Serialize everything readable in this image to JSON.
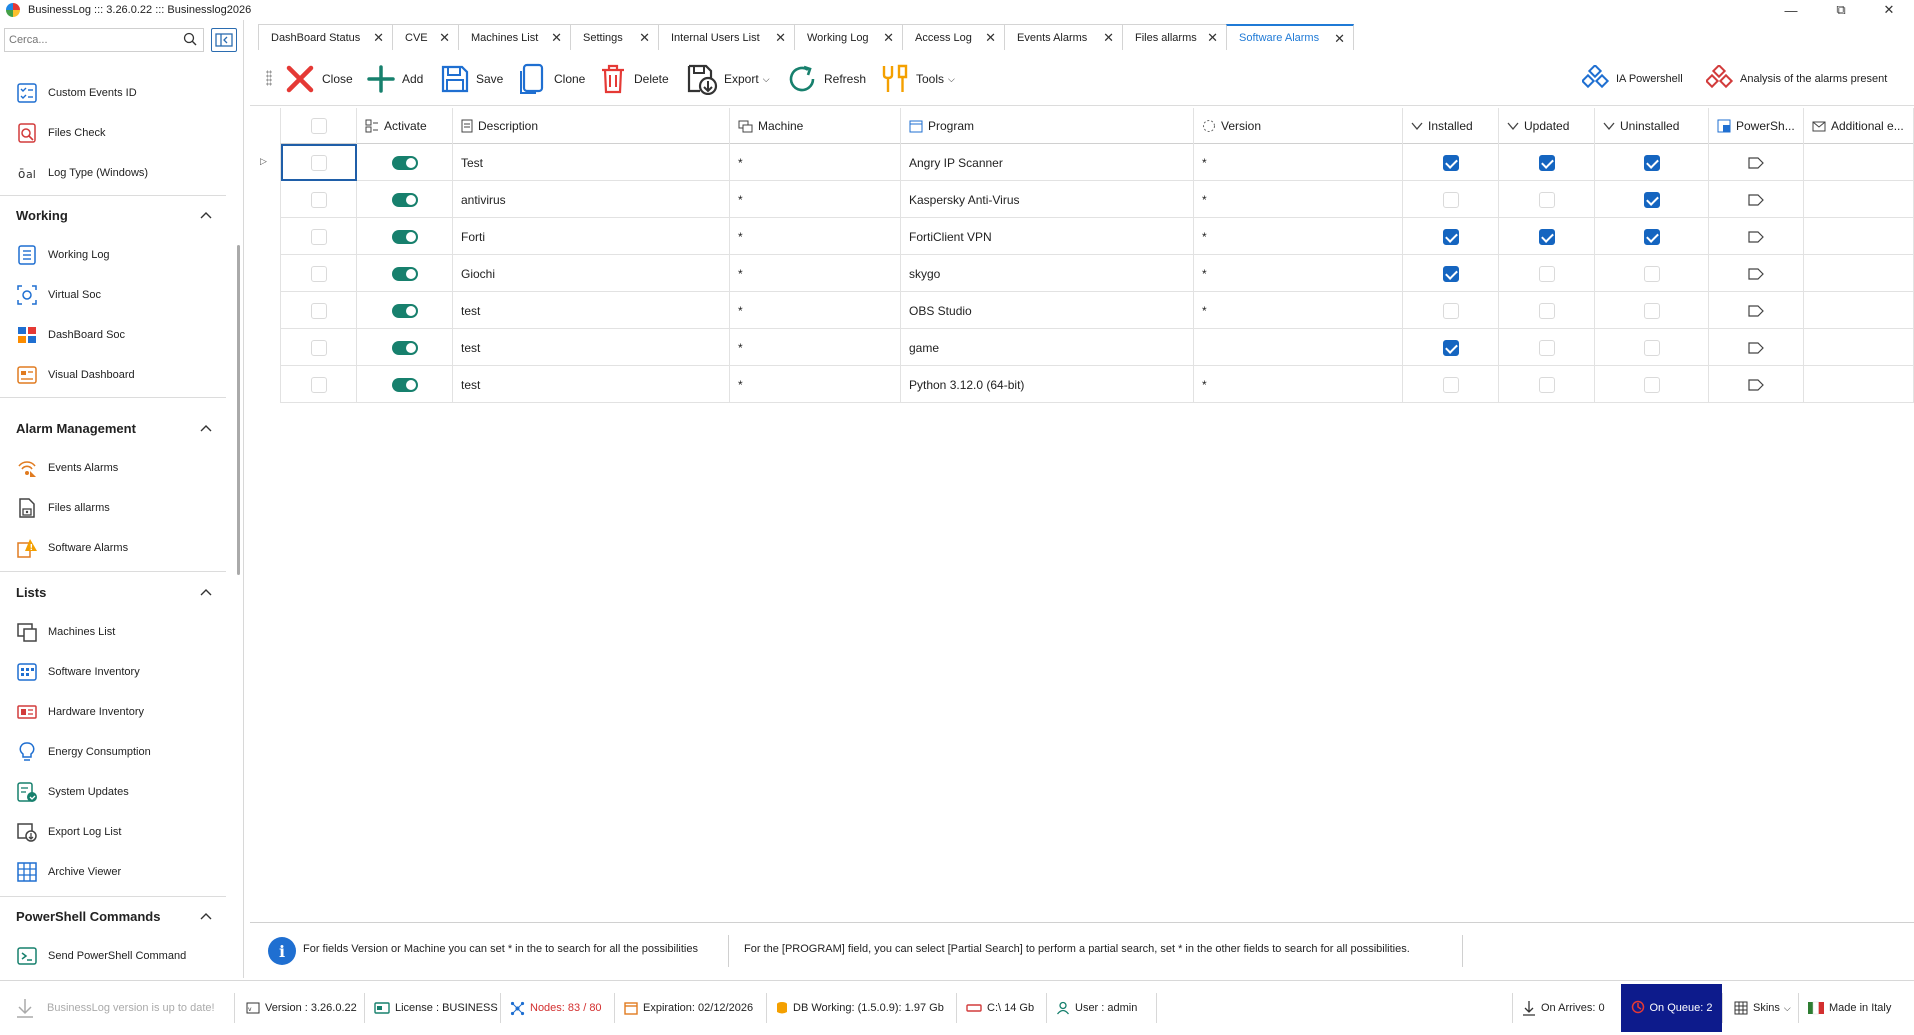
{
  "window": {
    "title": "BusinessLog ::: 3.26.0.22 ::: Businesslog2026"
  },
  "search": {
    "placeholder": "Cerca..."
  },
  "sidebar": {
    "top_items": [
      {
        "label": "Custom Events ID",
        "icon": "custom-events-icon"
      },
      {
        "label": "Files Check",
        "icon": "files-check-icon"
      },
      {
        "label": "Log Type (Windows)",
        "icon": "log-type-icon"
      }
    ],
    "sections": [
      {
        "title": "Working",
        "items": [
          {
            "label": "Working Log",
            "icon": "working-log-icon"
          },
          {
            "label": "Virtual Soc",
            "icon": "virtual-soc-icon"
          },
          {
            "label": "DashBoard Soc",
            "icon": "dashboard-soc-icon"
          },
          {
            "label": "Visual Dashboard",
            "icon": "visual-dashboard-icon"
          }
        ]
      },
      {
        "title": "Alarm Management",
        "items": [
          {
            "label": "Events Alarms",
            "icon": "events-alarms-icon"
          },
          {
            "label": "Files allarms",
            "icon": "files-alarms-icon"
          },
          {
            "label": "Software Alarms",
            "icon": "software-alarms-icon"
          }
        ]
      },
      {
        "title": "Lists",
        "items": [
          {
            "label": "Machines List",
            "icon": "machines-list-icon"
          },
          {
            "label": "Software Inventory",
            "icon": "software-inventory-icon"
          },
          {
            "label": "Hardware Inventory",
            "icon": "hardware-inventory-icon"
          },
          {
            "label": "Energy Consumption",
            "icon": "energy-icon"
          },
          {
            "label": "System Updates",
            "icon": "system-updates-icon"
          },
          {
            "label": "Export Log List",
            "icon": "export-log-icon"
          },
          {
            "label": "Archive Viewer",
            "icon": "archive-viewer-icon"
          }
        ]
      },
      {
        "title": "PowerShell Commands",
        "items": [
          {
            "label": "Send PowerShell Command",
            "icon": "send-powershell-icon"
          }
        ]
      }
    ]
  },
  "tabs": [
    {
      "label": "DashBoard Status"
    },
    {
      "label": "CVE"
    },
    {
      "label": "Machines List"
    },
    {
      "label": "Settings"
    },
    {
      "label": "Internal Users List"
    },
    {
      "label": "Working Log"
    },
    {
      "label": "Access Log"
    },
    {
      "label": "Events Alarms"
    },
    {
      "label": "Files allarms"
    },
    {
      "label": "Software Alarms",
      "active": true
    }
  ],
  "toolbar": {
    "close": "Close",
    "add": "Add",
    "save": "Save",
    "clone": "Clone",
    "delete": "Delete",
    "export": "Export",
    "refresh": "Refresh",
    "tools": "Tools",
    "ia_powershell": "IA Powershell",
    "analysis": "Analysis of the alarms present"
  },
  "grid": {
    "columns": {
      "activate": "Activate",
      "description": "Description",
      "machine": "Machine",
      "program": "Program",
      "version": "Version",
      "installed": "Installed",
      "updated": "Updated",
      "uninstalled": "Uninstalled",
      "powershell": "PowerSh...",
      "additional": "Additional e..."
    },
    "rows": [
      {
        "description": "Test",
        "machine": "*",
        "program": "Angry IP Scanner",
        "version": "*",
        "installed": true,
        "updated": true,
        "uninstalled": true
      },
      {
        "description": "antivirus",
        "machine": "*",
        "program": "Kaspersky Anti-Virus",
        "version": "*",
        "installed": false,
        "updated": false,
        "uninstalled": true
      },
      {
        "description": "Forti",
        "machine": "*",
        "program": "FortiClient VPN",
        "version": "*",
        "installed": true,
        "updated": true,
        "uninstalled": true
      },
      {
        "description": "Giochi",
        "machine": "*",
        "program": "skygo",
        "version": "*",
        "installed": true,
        "updated": false,
        "uninstalled": false
      },
      {
        "description": "test",
        "machine": "*",
        "program": "OBS Studio",
        "version": "*",
        "installed": false,
        "updated": false,
        "uninstalled": false
      },
      {
        "description": "test",
        "machine": "*",
        "program": "game",
        "version": "",
        "installed": true,
        "updated": false,
        "uninstalled": false
      },
      {
        "description": "test",
        "machine": "*",
        "program": "Python 3.12.0 (64-bit)",
        "version": "*",
        "installed": false,
        "updated": false,
        "uninstalled": false
      }
    ]
  },
  "info": {
    "text1": "For fields Version or Machine you can set * in the to search for all the possibilities",
    "text2": "For the [PROGRAM] field, you can select [Partial Search] to perform a partial search, set * in the other fields to search for all possibilities."
  },
  "status": {
    "update": "BusinessLog version is up to date!",
    "version": "Version : 3.26.0.22",
    "license": "License : BUSINESS",
    "nodes": "Nodes: 83 / 80",
    "expiration": "Expiration: 02/12/2026",
    "db": "DB Working: (1.5.0.9): 1.97 Gb",
    "disk": "C:\\ 14 Gb",
    "user": "User : admin",
    "on_arrives": "On Arrives: 0",
    "on_queue": "On Queue: 2",
    "skins": "Skins",
    "made_in": "Made in Italy"
  },
  "colors": {
    "accent": "#1f7ad6",
    "check": "#1565c0",
    "toggle": "#17806d",
    "queue_bg": "#0d1b8c",
    "nodes_warning": "#d32f2f"
  }
}
